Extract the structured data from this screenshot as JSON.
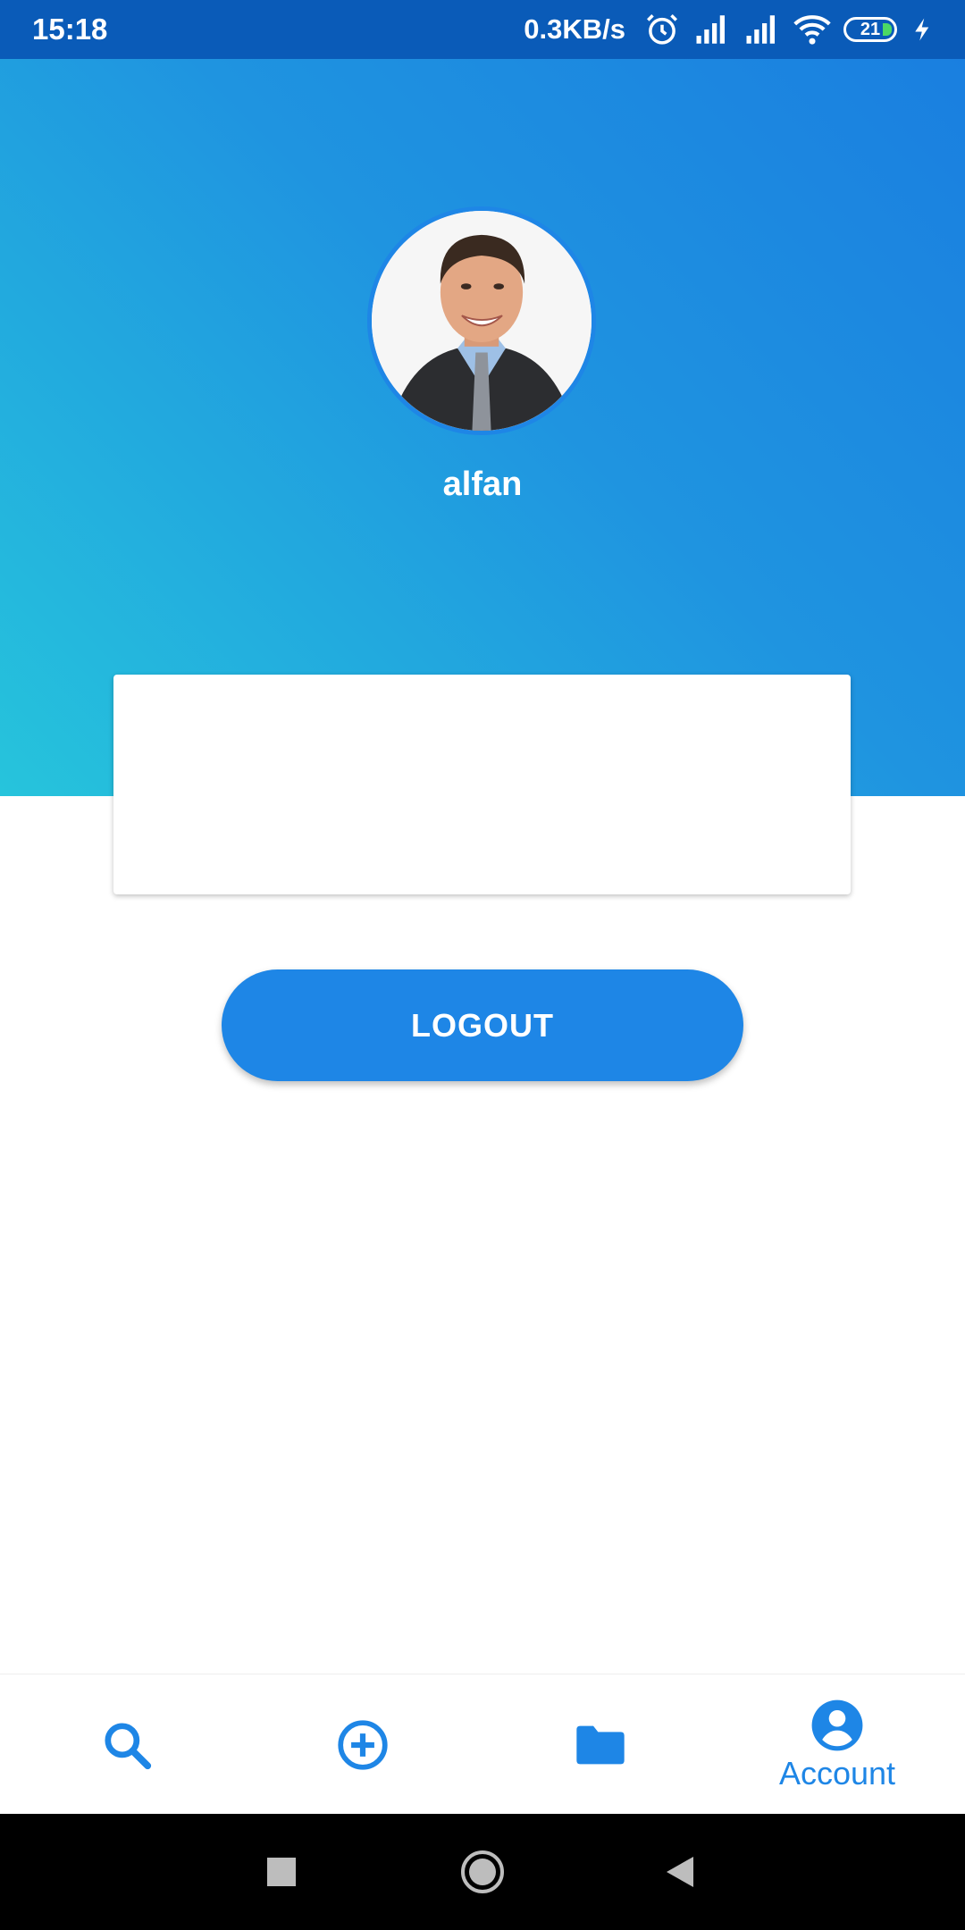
{
  "status_bar": {
    "time": "15:18",
    "network_speed": "0.3KB/s",
    "battery_level": "21",
    "icons": [
      "alarm-icon",
      "signal-icon",
      "signal-icon",
      "wifi-icon",
      "battery-icon",
      "charging-icon"
    ]
  },
  "profile": {
    "username": "alfan",
    "avatar": "profile-photo"
  },
  "actions": {
    "logout_label": "LOGOUT"
  },
  "bottom_nav": {
    "items": [
      {
        "icon": "search-icon",
        "label": ""
      },
      {
        "icon": "add-circle-icon",
        "label": ""
      },
      {
        "icon": "folder-icon",
        "label": ""
      },
      {
        "icon": "account-icon",
        "label": "Account",
        "active": true
      }
    ]
  },
  "colors": {
    "status_bar": "#0a5bb8",
    "accent": "#1e86e6",
    "gradient_start": "#1a7fe0",
    "gradient_end": "#26c4dc"
  }
}
